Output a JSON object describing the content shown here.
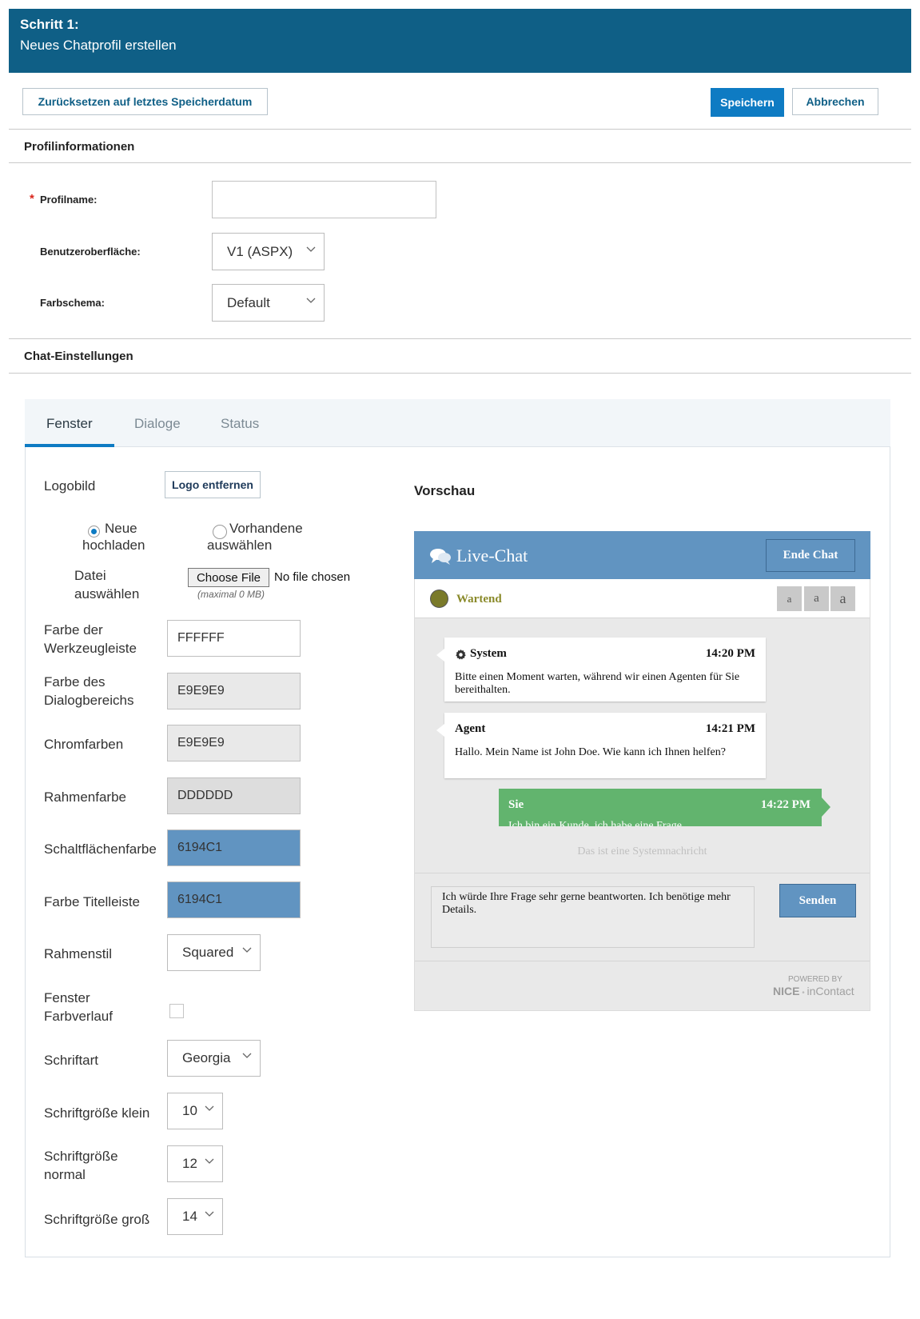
{
  "header": {
    "step": "Schritt 1:",
    "title": "Neues Chatprofil erstellen"
  },
  "toolbar": {
    "reset_label": "Zurücksetzen auf letztes Speicherdatum",
    "save_label": "Speichern",
    "cancel_label": "Abbrechen"
  },
  "profile_section": {
    "title": "Profilinformationen",
    "name_label": "Profilname:",
    "name_value": "",
    "ui_label": "Benutzeroberfläche:",
    "ui_value": "V1 (ASPX)",
    "scheme_label": "Farbschema:",
    "scheme_value": "Default"
  },
  "chat_section": {
    "title": "Chat-Einstellungen"
  },
  "tabs": [
    "Fenster",
    "Dialoge",
    "Status"
  ],
  "window_tab": {
    "logo_label": "Logobild",
    "logo_remove": "Logo entfernen",
    "radio_new_line1": "Neue",
    "radio_new_line2": "hochladen",
    "radio_existing_line1": "Vorhandene",
    "radio_existing_line2": "auswählen",
    "file_label_line1": "Datei",
    "file_label_line2": "auswählen",
    "file_button": "Choose File",
    "file_status": "No file chosen",
    "file_hint": "(maximal 0 MB)",
    "toolbar_color_label_1": "Farbe der",
    "toolbar_color_label_2": "Werkzeugleiste",
    "toolbar_color": "FFFFFF",
    "dialog_color_label_1": "Farbe des",
    "dialog_color_label_2": "Dialogbereichs",
    "dialog_color": "E9E9E9",
    "chrome_color_label": "Chromfarben",
    "chrome_color": "E9E9E9",
    "border_color_label": "Rahmenfarbe",
    "border_color": "DDDDDD",
    "button_color_label": "Schaltflächenfarbe",
    "button_color": "6194C1",
    "title_color_label": "Farbe Titelleiste",
    "title_color": "6194C1",
    "border_style_label": "Rahmenstil",
    "border_style": "Squared",
    "gradient_label_1": "Fenster",
    "gradient_label_2": "Farbverlauf",
    "font_label": "Schriftart",
    "font_value": "Georgia",
    "font_small_label": "Schriftgröße klein",
    "font_small": "10",
    "font_normal_label_1": "Schriftgröße",
    "font_normal_label_2": "normal",
    "font_normal": "12",
    "font_large_label": "Schriftgröße groß",
    "font_large": "14"
  },
  "preview": {
    "title": "Vorschau",
    "chat_title": "Live-Chat",
    "end_chat": "Ende Chat",
    "status": "Wartend",
    "size_buttons": [
      "a",
      "a",
      "a"
    ],
    "messages": [
      {
        "who": "System",
        "time": "14:20 PM",
        "text": "Bitte einen Moment warten, während wir einen Agenten für Sie bereithalten."
      },
      {
        "who": "Agent",
        "time": "14:21 PM",
        "text": "Hallo. Mein Name ist John Doe. Wie kann ich Ihnen helfen?"
      },
      {
        "who": "Sie",
        "time": "14:22 PM",
        "text": "Ich bin ein Kunde, ich habe eine Frage."
      }
    ],
    "system_note": "Das ist eine Systemnachricht",
    "input_text": "Ich würde Ihre Frage sehr gerne beantworten. Ich benötige mehr Details.",
    "send": "Senden",
    "powered_by": "POWERED BY",
    "brand_nice": "NICE",
    "brand_incontact": "inContact"
  },
  "colors": {
    "header": "#0f5f86",
    "primary": "#0e7bc3",
    "chat_title": "#6194C1",
    "customer": "#62b46e",
    "status_dot": "#7a7a2a"
  }
}
